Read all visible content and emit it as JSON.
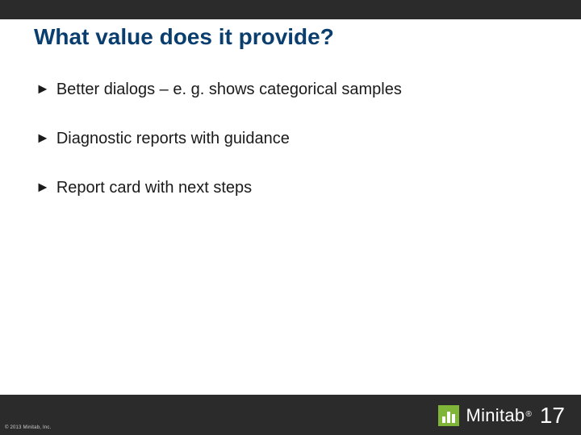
{
  "title": "What value does it provide?",
  "bullets": {
    "items": [
      {
        "text": "Better dialogs – e. g. shows categorical samples"
      },
      {
        "text": "Diagnostic reports with guidance"
      },
      {
        "text": "Report card with next steps"
      }
    ]
  },
  "footer": {
    "copyright": "© 2013 Minitab, Inc.",
    "brand_name": "Minitab",
    "brand_reg": "®",
    "brand_version": "17"
  }
}
